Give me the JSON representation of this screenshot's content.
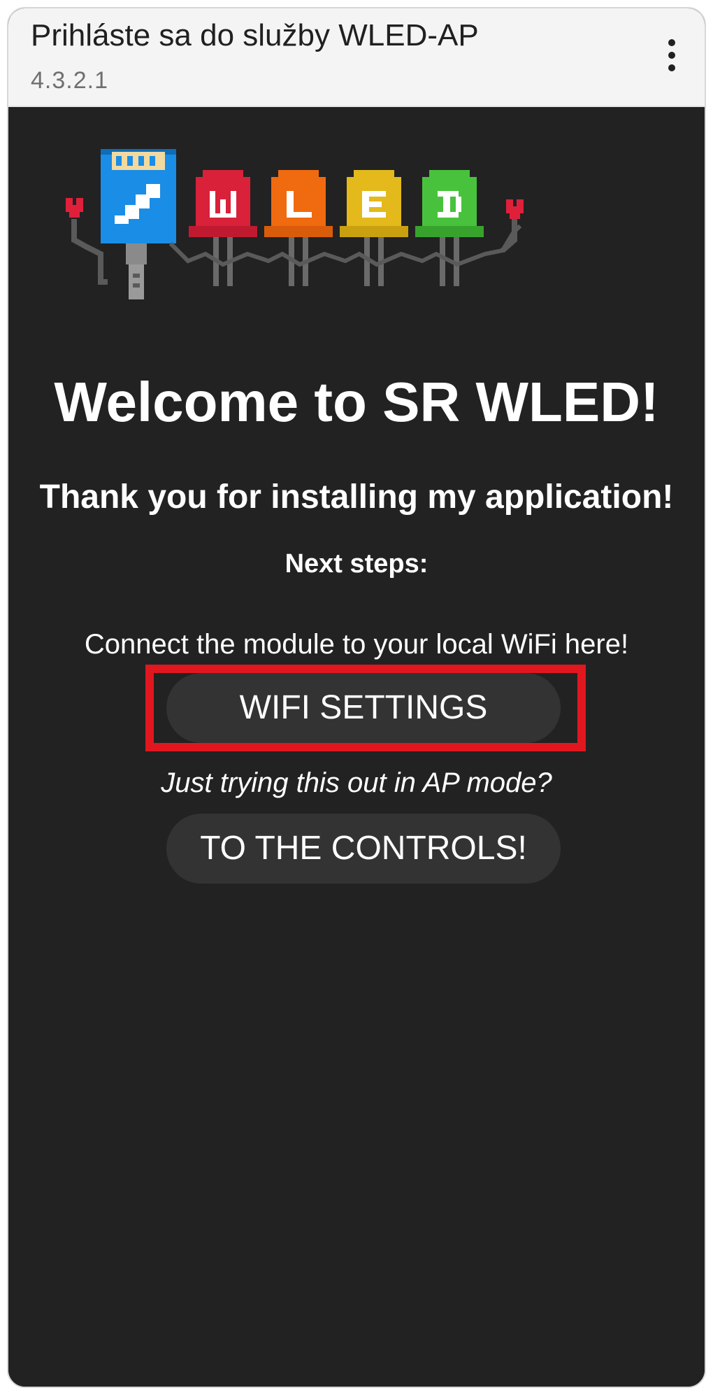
{
  "dialog": {
    "title": "Prihláste sa do služby WLED-AP",
    "subtitle": "4.3.2.1",
    "menu_icon": "more-vertical-icon"
  },
  "page": {
    "logo": "wled-pixel-logo",
    "heading": "Welcome to SR WLED!",
    "thanks": "Thank you for installing my application!",
    "next_steps": "Next steps:",
    "connect_text": "Connect the module to your local WiFi here!",
    "wifi_button": "WIFI SETTINGS",
    "ap_text": "Just trying this out in AP mode?",
    "controls_button": "TO THE CONTROLS!"
  },
  "colors": {
    "background": "#222222",
    "button": "#333333",
    "highlight": "#e1171f",
    "titlebar": "#f4f4f4"
  }
}
